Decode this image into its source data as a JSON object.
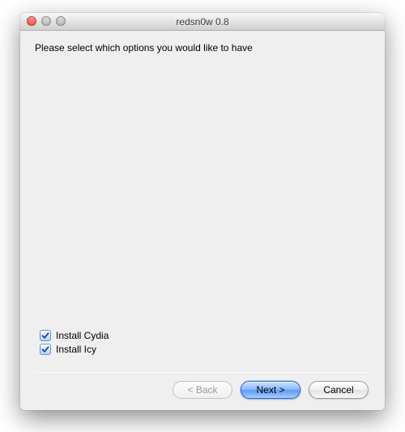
{
  "window": {
    "title": "redsn0w 0.8"
  },
  "content": {
    "instructions": "Please select which options you would like to have"
  },
  "options": [
    {
      "label": "Install Cydia",
      "checked": true
    },
    {
      "label": "Install Icy",
      "checked": true
    }
  ],
  "buttons": {
    "back": "< Back",
    "next": "Next >",
    "cancel": "Cancel"
  }
}
